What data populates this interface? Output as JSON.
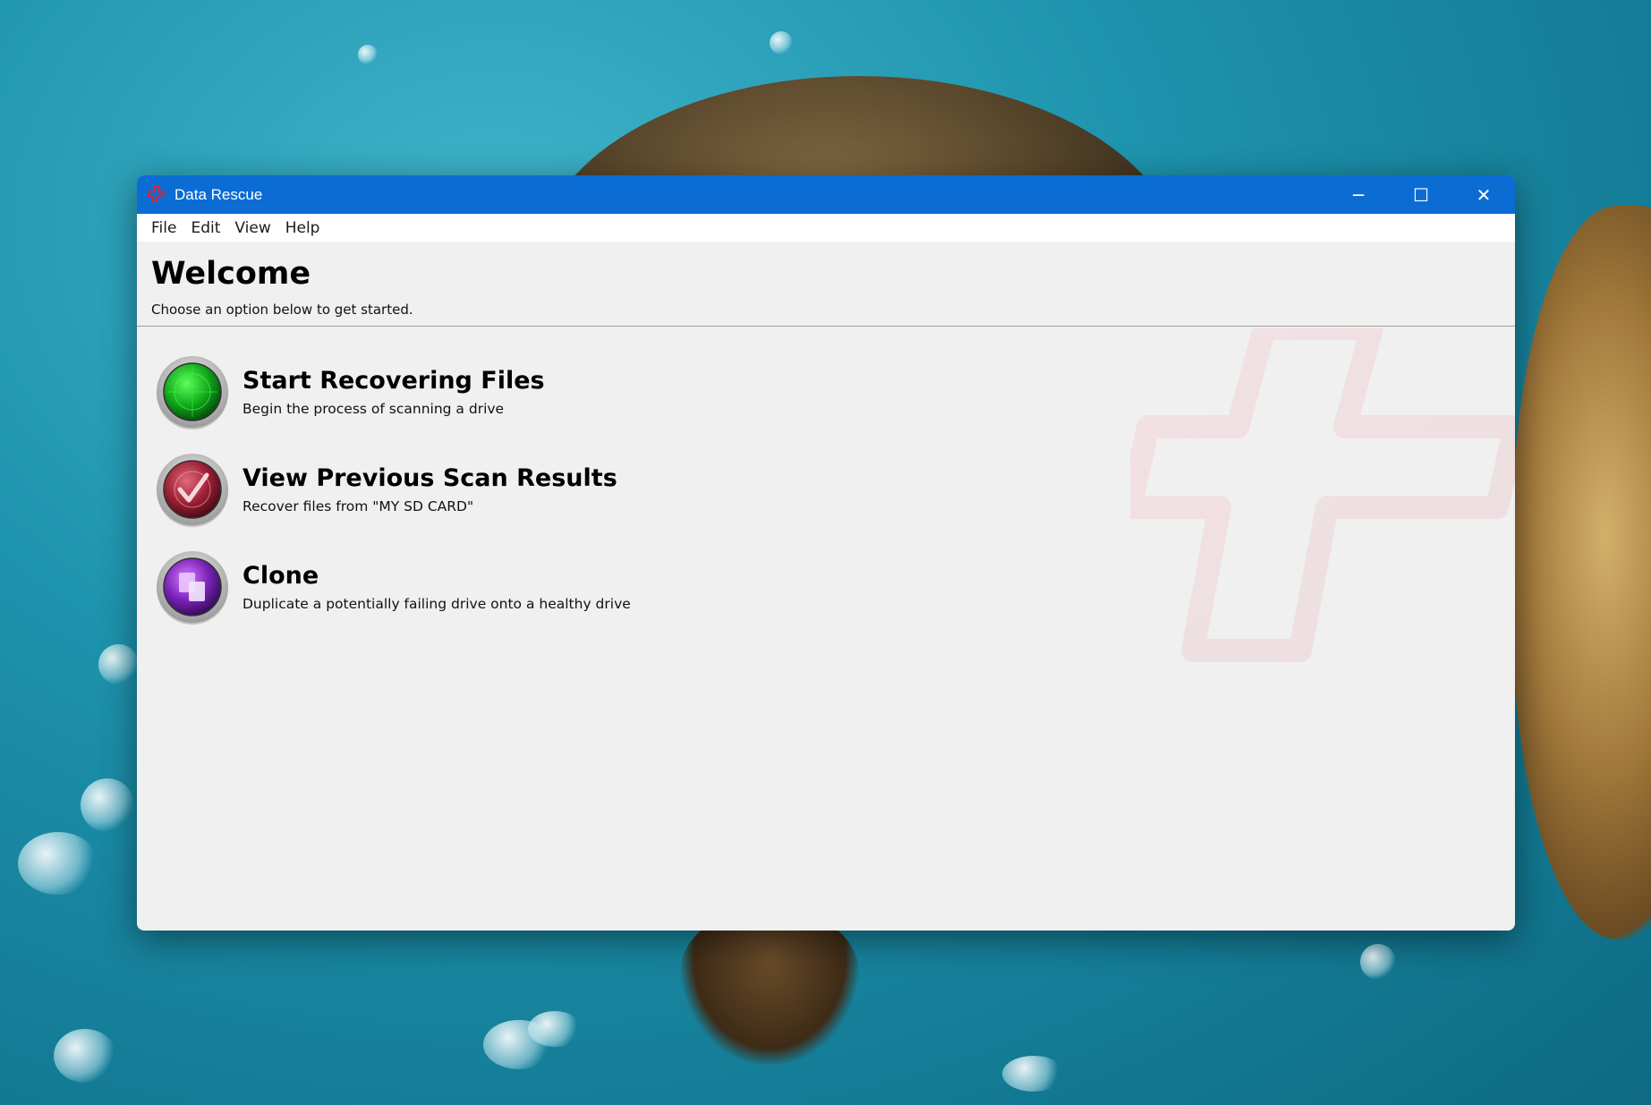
{
  "window": {
    "title": "Data Rescue",
    "controls": {
      "minimize": "─",
      "maximize": "☐",
      "close": "✕"
    }
  },
  "menubar": {
    "items": [
      "File",
      "Edit",
      "View",
      "Help"
    ]
  },
  "header": {
    "title": "Welcome",
    "subtitle": "Choose an option below to get started."
  },
  "options": [
    {
      "title": "Start Recovering Files",
      "description": "Begin the process of scanning a drive",
      "icon": "radar-icon",
      "color": "#1bb32b"
    },
    {
      "title": "View Previous Scan Results",
      "description": "Recover files from \"MY SD CARD\"",
      "icon": "checkmark-radar-icon",
      "color": "#a8253a"
    },
    {
      "title": "Clone",
      "description": "Duplicate a potentially failing drive onto a healthy drive",
      "icon": "clone-icon",
      "color": "#8b2cc4"
    }
  ],
  "colors": {
    "titlebar": "#0b6dd4",
    "accent_red": "#d4283a",
    "window_bg": "#f0f0f0"
  }
}
